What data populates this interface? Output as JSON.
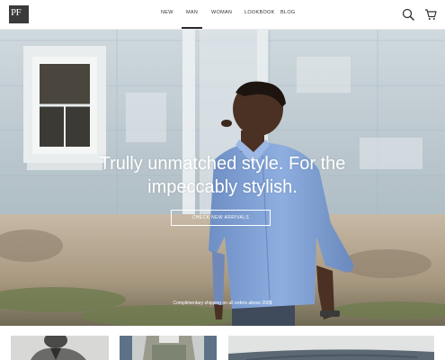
{
  "logo": {
    "text": "PF"
  },
  "nav": {
    "items": [
      {
        "label": "NEW"
      },
      {
        "label": "MAN"
      },
      {
        "label": "WOMAN"
      },
      {
        "label": "LOOKBOOK"
      },
      {
        "label": "BLOG"
      }
    ],
    "active": "MAN"
  },
  "header_icons": {
    "search": "search-icon",
    "cart": "cart-icon"
  },
  "hero": {
    "title_line1": "Trully unmatched style. For the",
    "title_line2": "impeccably stylish.",
    "button_label": "CHECK NEW ARRIVALS",
    "note": "Complimentary shipping on all orders above 200$"
  },
  "colors": {
    "accent": "#2a2a2a",
    "shirt": "#7f9fd1",
    "wall": "#b7c6cf"
  }
}
